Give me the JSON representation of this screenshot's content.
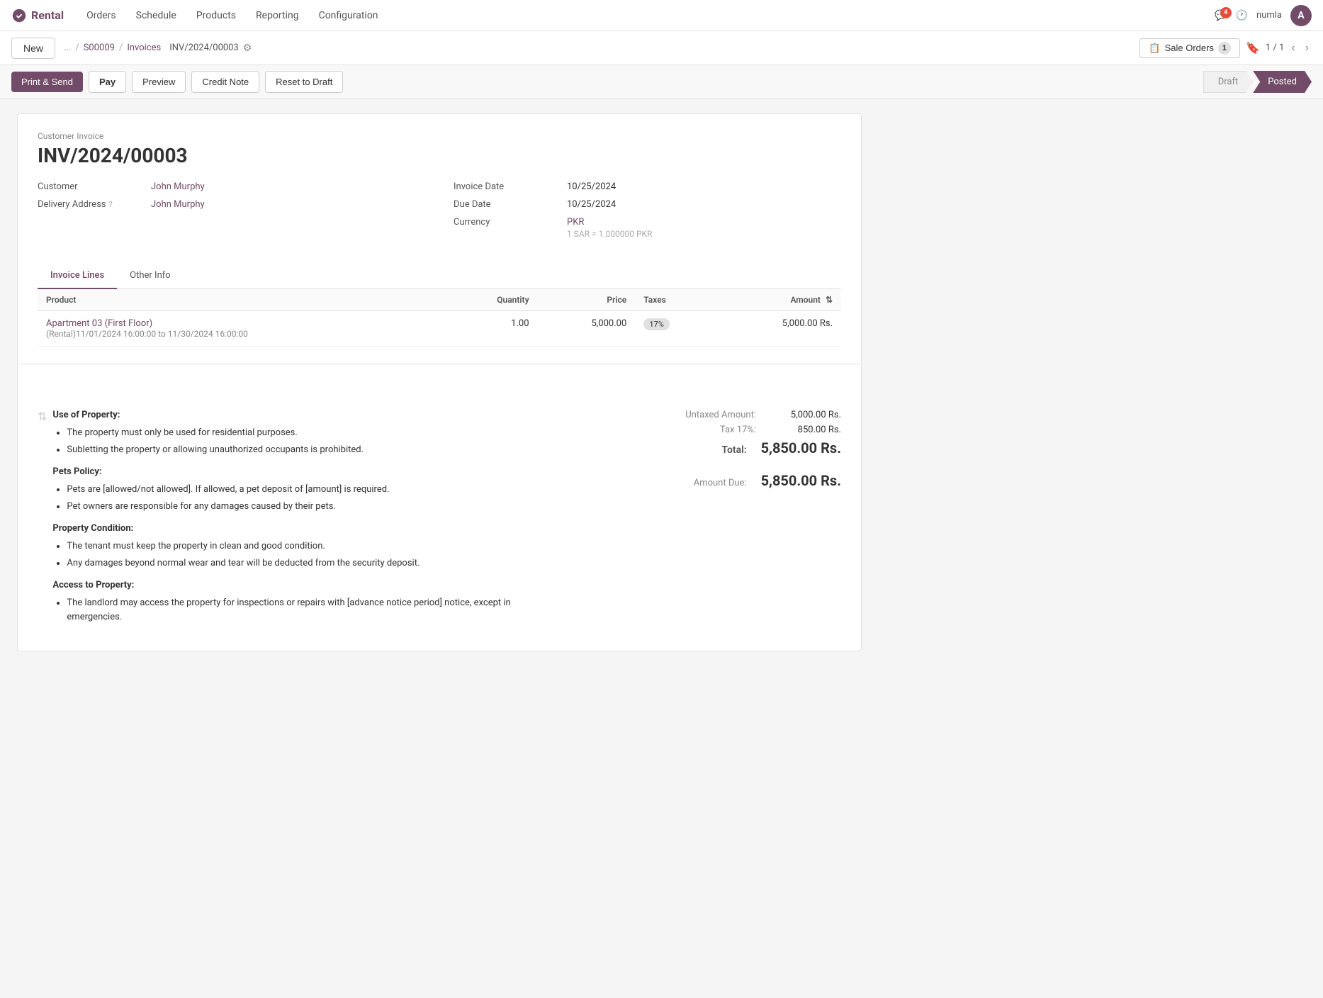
{
  "app": {
    "logo_text": "Rental",
    "nav_items": [
      "Orders",
      "Schedule",
      "Products",
      "Reporting",
      "Configuration"
    ],
    "nav_notification_count": "4",
    "nav_username": "numla",
    "nav_avatar_letter": "A"
  },
  "secondary_bar": {
    "new_label": "New",
    "breadcrumb_ellipsis": "...",
    "breadcrumb_s00009": "S00009",
    "breadcrumb_invoices": "Invoices",
    "record_name": "INV/2024/00003",
    "sale_orders_label": "Sale Orders",
    "sale_orders_count": "1",
    "paging": "1 / 1"
  },
  "actions": {
    "print_send": "Print & Send",
    "pay": "Pay",
    "preview": "Preview",
    "credit_note": "Credit Note",
    "reset_to_draft": "Reset to Draft",
    "status_draft": "Draft",
    "status_posted": "Posted"
  },
  "document": {
    "type_label": "Customer Invoice",
    "title": "INV/2024/00003",
    "customer_label": "Customer",
    "customer_value": "John Murphy",
    "delivery_address_label": "Delivery Address",
    "delivery_address_help": "?",
    "delivery_address_value": "John Murphy",
    "invoice_date_label": "Invoice Date",
    "invoice_date_value": "10/25/2024",
    "due_date_label": "Due Date",
    "due_date_value": "10/25/2024",
    "currency_label": "Currency",
    "currency_value": "PKR",
    "currency_note": "1 SAR = 1.000000 PKR"
  },
  "tabs": [
    "Invoice Lines",
    "Other Info"
  ],
  "active_tab": "Invoice Lines",
  "table": {
    "headers": [
      "Product",
      "Quantity",
      "Price",
      "Taxes",
      "Amount"
    ],
    "rows": [
      {
        "product_name": "Apartment 03 (First Floor)",
        "product_sub": "(Rental)11/01/2024 16:00:00 to 11/30/2024 16:00:00",
        "quantity": "1.00",
        "price": "5,000.00",
        "tax_badge": "17%",
        "amount": "5,000.00 Rs."
      }
    ]
  },
  "terms": {
    "use_of_property_title": "Use of Property:",
    "use_of_property_items": [
      "The property must only be used for residential purposes.",
      "Subletting the property or allowing unauthorized occupants is prohibited."
    ],
    "pets_policy_title": "Pets Policy:",
    "pets_policy_items": [
      "Pets are [allowed/not allowed]. If allowed, a pet deposit of [amount] is required.",
      "Pet owners are responsible for any damages caused by their pets."
    ],
    "property_condition_title": "Property Condition:",
    "property_condition_items": [
      "The tenant must keep the property in clean and good condition.",
      "Any damages beyond normal wear and tear will be deducted from the security deposit."
    ],
    "access_title": "Access to Property:",
    "access_items": [
      "The landlord may access the property for inspections or repairs with [advance notice period] notice, except in emergencies."
    ]
  },
  "totals": {
    "untaxed_label": "Untaxed Amount:",
    "untaxed_value": "5,000.00 Rs.",
    "tax_label": "Tax 17%:",
    "tax_value": "850.00 Rs.",
    "total_label": "Total:",
    "total_value": "5,850.00 Rs.",
    "amount_due_label": "Amount Due:",
    "amount_due_value": "5,850.00 Rs."
  }
}
